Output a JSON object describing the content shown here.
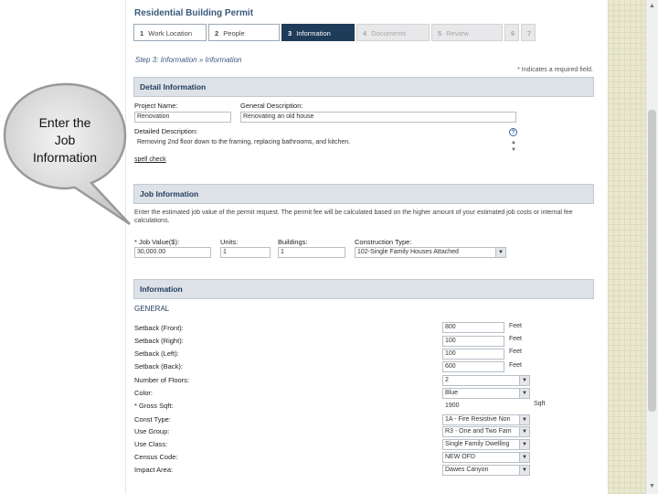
{
  "page_title": "Residential Building Permit",
  "steps": [
    {
      "num": "1",
      "label": "Work Location"
    },
    {
      "num": "2",
      "label": "People"
    },
    {
      "num": "3",
      "label": "Information"
    },
    {
      "num": "4",
      "label": "Documents"
    },
    {
      "num": "5",
      "label": "Review"
    },
    {
      "num": "6",
      "label": ""
    },
    {
      "num": "7",
      "label": ""
    }
  ],
  "step_heading": "Step 3: Information » Information",
  "required_note": "* Indicates a required field.",
  "detail_section": {
    "title": "Detail Information",
    "project_name_label": "Project Name:",
    "project_name_value": "Renovation",
    "general_desc_label": "General Description:",
    "general_desc_value": "Renovating an old house",
    "detailed_desc_label": "Detailed Description:",
    "detailed_desc_value": "Removing 2nd floor down to the framing, replacing bathrooms, and kitchen.",
    "help_icon": "?",
    "spell_check": "spell check"
  },
  "job_section": {
    "title": "Job Information",
    "description": "Enter the estimated job value of the permit request.  The permit fee will be calculated based on the higher amount of your estimated job costs or internal fee calculations.",
    "job_value_label": "* Job Value($):",
    "job_value": "30,000.00",
    "units_label": "Units:",
    "units_value": "1",
    "buildings_label": "Buildings:",
    "buildings_value": "1",
    "construction_type_label": "Construction Type:",
    "construction_type_value": "102-Single Family Houses Attached"
  },
  "info_section": {
    "title": "Information",
    "general_heading": "GENERAL",
    "fields": [
      {
        "label": "Setback (Front):",
        "value": "800",
        "unit": "Feet"
      },
      {
        "label": "Setback (Right):",
        "value": "100",
        "unit": "Feet"
      },
      {
        "label": "Setback (Left):",
        "value": "100",
        "unit": "Feet"
      },
      {
        "label": "Setback (Back):",
        "value": "600",
        "unit": "Feet"
      },
      {
        "label": "Number of Floors:",
        "value": "2",
        "unit": ""
      },
      {
        "label": "Color:",
        "value": "Blue",
        "unit": ""
      },
      {
        "label": "* Gross Sqft:",
        "value": "1900",
        "unit": "Sqft"
      },
      {
        "label": "Const Type:",
        "value": "1A - Fire Resistive Non",
        "unit": ""
      },
      {
        "label": "Use Group:",
        "value": "R3 - One and Two Fam",
        "unit": ""
      },
      {
        "label": "Use Class:",
        "value": "Single Family Dwelling",
        "unit": ""
      },
      {
        "label": "Census Code:",
        "value": "NEW OFD",
        "unit": ""
      },
      {
        "label": "Impact Area:",
        "value": "Dawes Canyon",
        "unit": ""
      }
    ]
  },
  "callout": {
    "line1": "Enter the",
    "line2": "Job",
    "line3": "Information"
  },
  "scrollbar": {
    "up": "▲",
    "down": "▼"
  }
}
